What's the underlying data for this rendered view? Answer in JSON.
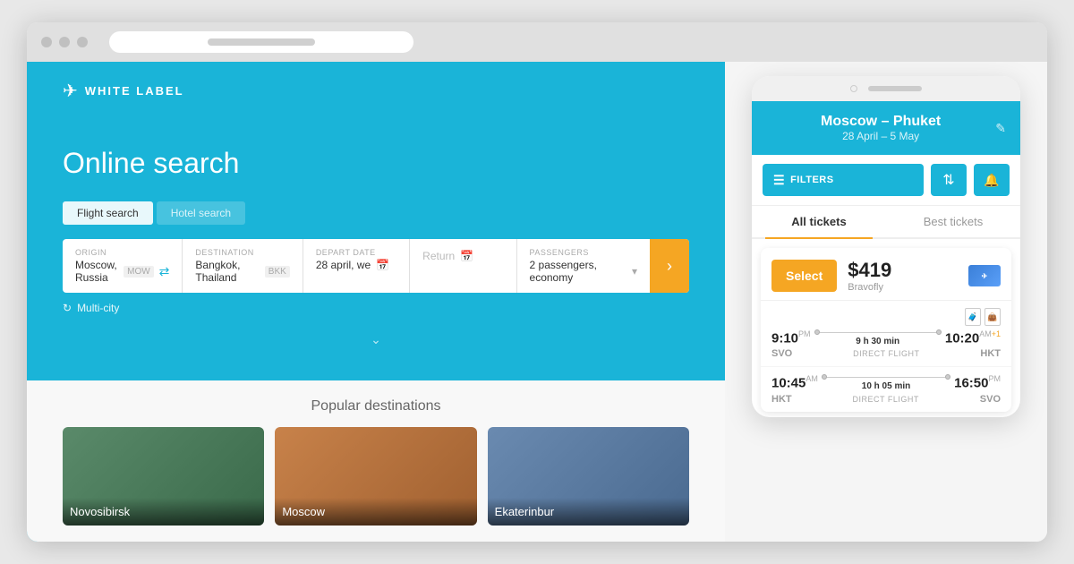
{
  "browser": {
    "url_placeholder": ""
  },
  "website": {
    "logo": "WHITE LABEL",
    "hero_title": "Online search",
    "tabs": [
      {
        "label": "Flight search",
        "active": true
      },
      {
        "label": "Hotel search",
        "active": false
      }
    ],
    "search": {
      "origin_label": "ORIGIN",
      "origin_value": "Moscow, Russia",
      "origin_code": "MOW",
      "destination_label": "DESTINATION",
      "destination_value": "Bangkok, Thailand",
      "destination_code": "BKK",
      "depart_label": "DEPART DATE",
      "depart_value": "28 april, we",
      "return_placeholder": "Return",
      "passengers_label": "PASSENGERS",
      "passengers_value": "2 passengers, economy",
      "multi_city": "Multi-city"
    },
    "popular_title": "Popular destinations",
    "popular_cards": [
      {
        "name": "Novosibirsk",
        "bg": "novosibirsk"
      },
      {
        "name": "Moscow",
        "bg": "moscow"
      },
      {
        "name": "Ekaterinbur",
        "bg": "ekaterinburg"
      }
    ]
  },
  "mobile_app": {
    "header": {
      "route": "Moscow – Phuket",
      "dates": "28 April – 5 May",
      "edit_icon": "✎"
    },
    "filters": {
      "main_btn": "FILTERS",
      "sort_icon": "≡",
      "alert_icon": "🔔"
    },
    "tabs": [
      {
        "label": "All tickets",
        "active": true
      },
      {
        "label": "Best tickets",
        "active": false
      }
    ],
    "ticket": {
      "select_btn": "Select",
      "price": "$419",
      "provider": "Bravofly",
      "flights": [
        {
          "dep_time": "9:10",
          "dep_period": "PM",
          "duration": "9 h 30 min",
          "arr_time": "10:20",
          "arr_period": "AM",
          "day_offset": "+1",
          "dep_airport": "SVO",
          "direct": "DIRECT FLIGHT",
          "arr_airport": "HKT"
        },
        {
          "dep_time": "10:45",
          "dep_period": "AM",
          "duration": "10 h 05 min",
          "arr_time": "16:50",
          "arr_period": "PM",
          "day_offset": "",
          "dep_airport": "HKT",
          "direct": "DIRECT FLIGHT",
          "arr_airport": "SVO"
        }
      ]
    }
  }
}
